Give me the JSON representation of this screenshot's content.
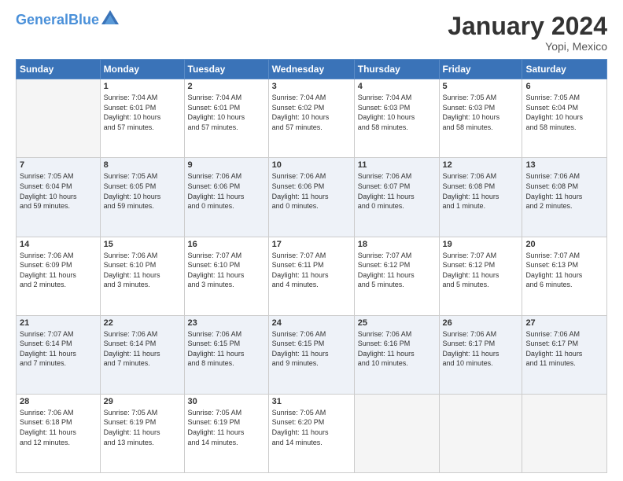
{
  "header": {
    "logo_line1": "General",
    "logo_line2": "Blue",
    "title": "January 2024",
    "subtitle": "Yopi, Mexico"
  },
  "weekdays": [
    "Sunday",
    "Monday",
    "Tuesday",
    "Wednesday",
    "Thursday",
    "Friday",
    "Saturday"
  ],
  "weeks": [
    [
      {
        "day": "",
        "info": ""
      },
      {
        "day": "1",
        "info": "Sunrise: 7:04 AM\nSunset: 6:01 PM\nDaylight: 10 hours\nand 57 minutes."
      },
      {
        "day": "2",
        "info": "Sunrise: 7:04 AM\nSunset: 6:01 PM\nDaylight: 10 hours\nand 57 minutes."
      },
      {
        "day": "3",
        "info": "Sunrise: 7:04 AM\nSunset: 6:02 PM\nDaylight: 10 hours\nand 57 minutes."
      },
      {
        "day": "4",
        "info": "Sunrise: 7:04 AM\nSunset: 6:03 PM\nDaylight: 10 hours\nand 58 minutes."
      },
      {
        "day": "5",
        "info": "Sunrise: 7:05 AM\nSunset: 6:03 PM\nDaylight: 10 hours\nand 58 minutes."
      },
      {
        "day": "6",
        "info": "Sunrise: 7:05 AM\nSunset: 6:04 PM\nDaylight: 10 hours\nand 58 minutes."
      }
    ],
    [
      {
        "day": "7",
        "info": "Sunrise: 7:05 AM\nSunset: 6:04 PM\nDaylight: 10 hours\nand 59 minutes."
      },
      {
        "day": "8",
        "info": "Sunrise: 7:05 AM\nSunset: 6:05 PM\nDaylight: 10 hours\nand 59 minutes."
      },
      {
        "day": "9",
        "info": "Sunrise: 7:06 AM\nSunset: 6:06 PM\nDaylight: 11 hours\nand 0 minutes."
      },
      {
        "day": "10",
        "info": "Sunrise: 7:06 AM\nSunset: 6:06 PM\nDaylight: 11 hours\nand 0 minutes."
      },
      {
        "day": "11",
        "info": "Sunrise: 7:06 AM\nSunset: 6:07 PM\nDaylight: 11 hours\nand 0 minutes."
      },
      {
        "day": "12",
        "info": "Sunrise: 7:06 AM\nSunset: 6:08 PM\nDaylight: 11 hours\nand 1 minute."
      },
      {
        "day": "13",
        "info": "Sunrise: 7:06 AM\nSunset: 6:08 PM\nDaylight: 11 hours\nand 2 minutes."
      }
    ],
    [
      {
        "day": "14",
        "info": "Sunrise: 7:06 AM\nSunset: 6:09 PM\nDaylight: 11 hours\nand 2 minutes."
      },
      {
        "day": "15",
        "info": "Sunrise: 7:06 AM\nSunset: 6:10 PM\nDaylight: 11 hours\nand 3 minutes."
      },
      {
        "day": "16",
        "info": "Sunrise: 7:07 AM\nSunset: 6:10 PM\nDaylight: 11 hours\nand 3 minutes."
      },
      {
        "day": "17",
        "info": "Sunrise: 7:07 AM\nSunset: 6:11 PM\nDaylight: 11 hours\nand 4 minutes."
      },
      {
        "day": "18",
        "info": "Sunrise: 7:07 AM\nSunset: 6:12 PM\nDaylight: 11 hours\nand 5 minutes."
      },
      {
        "day": "19",
        "info": "Sunrise: 7:07 AM\nSunset: 6:12 PM\nDaylight: 11 hours\nand 5 minutes."
      },
      {
        "day": "20",
        "info": "Sunrise: 7:07 AM\nSunset: 6:13 PM\nDaylight: 11 hours\nand 6 minutes."
      }
    ],
    [
      {
        "day": "21",
        "info": "Sunrise: 7:07 AM\nSunset: 6:14 PM\nDaylight: 11 hours\nand 7 minutes."
      },
      {
        "day": "22",
        "info": "Sunrise: 7:06 AM\nSunset: 6:14 PM\nDaylight: 11 hours\nand 7 minutes."
      },
      {
        "day": "23",
        "info": "Sunrise: 7:06 AM\nSunset: 6:15 PM\nDaylight: 11 hours\nand 8 minutes."
      },
      {
        "day": "24",
        "info": "Sunrise: 7:06 AM\nSunset: 6:15 PM\nDaylight: 11 hours\nand 9 minutes."
      },
      {
        "day": "25",
        "info": "Sunrise: 7:06 AM\nSunset: 6:16 PM\nDaylight: 11 hours\nand 10 minutes."
      },
      {
        "day": "26",
        "info": "Sunrise: 7:06 AM\nSunset: 6:17 PM\nDaylight: 11 hours\nand 10 minutes."
      },
      {
        "day": "27",
        "info": "Sunrise: 7:06 AM\nSunset: 6:17 PM\nDaylight: 11 hours\nand 11 minutes."
      }
    ],
    [
      {
        "day": "28",
        "info": "Sunrise: 7:06 AM\nSunset: 6:18 PM\nDaylight: 11 hours\nand 12 minutes."
      },
      {
        "day": "29",
        "info": "Sunrise: 7:05 AM\nSunset: 6:19 PM\nDaylight: 11 hours\nand 13 minutes."
      },
      {
        "day": "30",
        "info": "Sunrise: 7:05 AM\nSunset: 6:19 PM\nDaylight: 11 hours\nand 14 minutes."
      },
      {
        "day": "31",
        "info": "Sunrise: 7:05 AM\nSunset: 6:20 PM\nDaylight: 11 hours\nand 14 minutes."
      },
      {
        "day": "",
        "info": ""
      },
      {
        "day": "",
        "info": ""
      },
      {
        "day": "",
        "info": ""
      }
    ]
  ]
}
